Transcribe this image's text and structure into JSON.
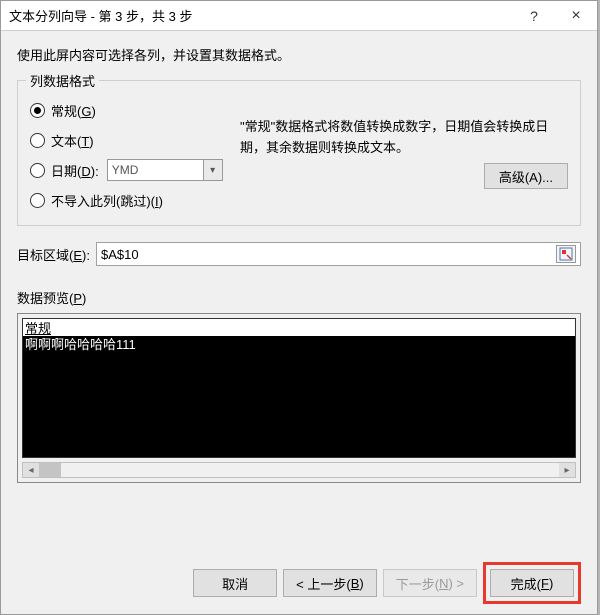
{
  "window": {
    "title": "文本分列向导 - 第 3 步，共 3 步",
    "help": "?",
    "close": "×"
  },
  "instruction": "使用此屏内容可选择各列，并设置其数据格式。",
  "format_group": {
    "legend": "列数据格式",
    "description": "\"常规\"数据格式将数值转换成数字，日期值会转换成日期，其余数据则转换成文本。",
    "advanced_label": "高级(A)...",
    "radios": {
      "general": {
        "pre": "常规(",
        "mn": "G",
        "post": ")",
        "checked": true
      },
      "text": {
        "pre": "文本(",
        "mn": "T",
        "post": ")",
        "checked": false
      },
      "date": {
        "pre": "日期(",
        "mn": "D",
        "post": "):",
        "checked": false,
        "value": "YMD"
      },
      "skip": {
        "pre": "不导入此列(跳过)(",
        "mn": "I",
        "post": ")",
        "checked": false
      }
    }
  },
  "destination": {
    "pre": "目标区域(",
    "mn": "E",
    "post": "):",
    "value": "$A$10"
  },
  "preview": {
    "pre": "数据预览(",
    "mn": "P",
    "post": ")",
    "header": "常规",
    "row1": "啊啊啊哈哈哈哈111"
  },
  "buttons": {
    "cancel": "取消",
    "back": {
      "label": "< 上一步(",
      "mn": "B",
      "post": ")"
    },
    "next": {
      "label": "下一步(",
      "mn": "N",
      "post": ") >"
    },
    "finish": {
      "label": "完成(",
      "mn": "F",
      "post": ")"
    }
  }
}
